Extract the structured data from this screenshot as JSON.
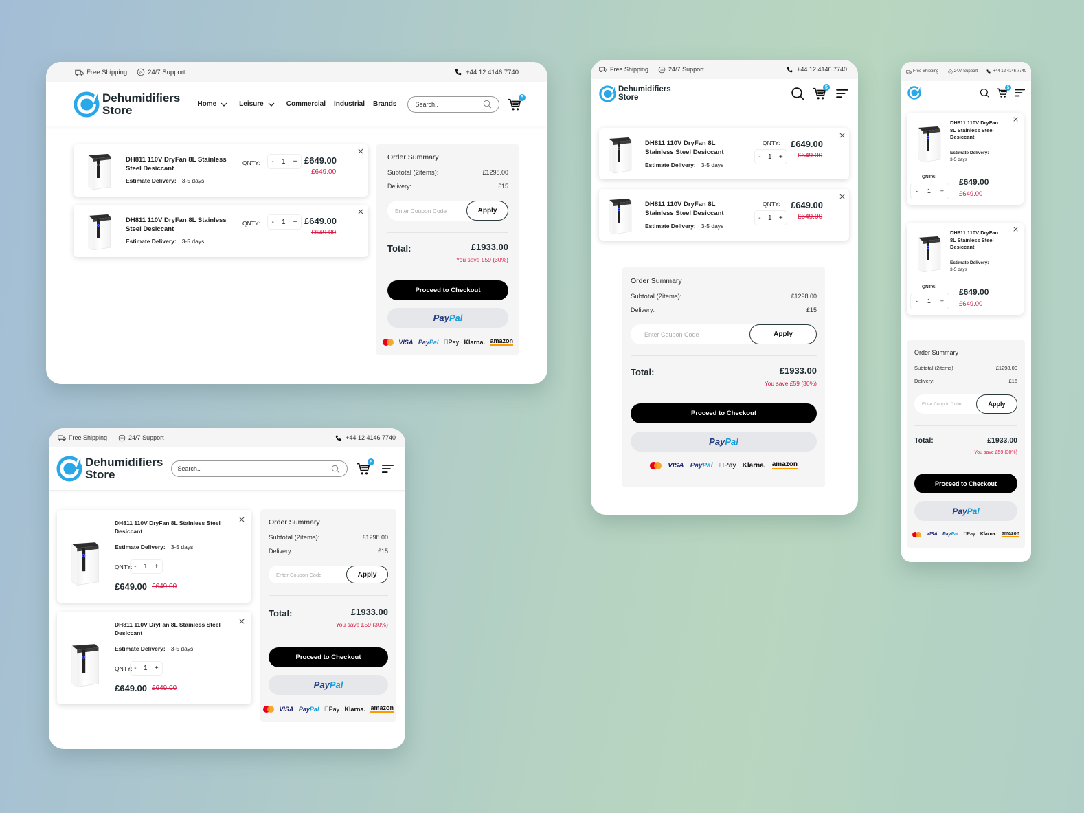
{
  "store": {
    "name_line1": "Dehumidifiers",
    "name_line2": "Store",
    "accent_color": "#2aa7e6",
    "sale_color": "#d81c45"
  },
  "topbar": {
    "shipping": "Free Shipping",
    "support": "24/7 Support",
    "phone": "+44 12 4146 7740"
  },
  "nav": {
    "items": [
      {
        "label": "Home",
        "has_dropdown": true
      },
      {
        "label": "Leisure",
        "has_dropdown": true
      },
      {
        "label": "Commercial",
        "has_dropdown": false
      },
      {
        "label": "Industrial",
        "has_dropdown": false
      },
      {
        "label": "Brands",
        "has_dropdown": false
      }
    ]
  },
  "search": {
    "placeholder": "Search.."
  },
  "cart": {
    "count": "5"
  },
  "icons": {
    "shipping": "truck-icon",
    "support": "clock-24-icon",
    "phone": "phone-icon",
    "search": "search-icon",
    "cart": "cart-icon",
    "menu": "menu-icon",
    "close": "close-icon",
    "dropdown": "chevron-down-icon"
  },
  "cart_items": [
    {
      "name": "DH811 110V DryFan 8L Stainless Steel Desiccant",
      "delivery_label": "Estimate Delivery:",
      "delivery_value": "3-5 days",
      "qty_label": "QNTY:",
      "qty": "1",
      "minus": "-",
      "plus": "+",
      "price": "£649.00",
      "old_price": "£649.00",
      "remove": "×"
    },
    {
      "name": "DH811 110V DryFan 8L Stainless Steel Desiccant",
      "delivery_label": "Estimate Delivery:",
      "delivery_value": "3-5 days",
      "qty_label": "QNTY:",
      "qty": "1",
      "minus": "-",
      "plus": "+",
      "price": "£649.00",
      "old_price": "£649.00",
      "remove": "×"
    }
  ],
  "summary": {
    "title": "Order Summary",
    "subtotal_label": "Subtotal (2items):",
    "subtotal_label_mobile": "Subtotal (2items)",
    "subtotal_value": "£1298.00",
    "delivery_label": "Delivery:",
    "delivery_value": "£15",
    "coupon_placeholder": "Enter Coupon Code",
    "apply_label": "Apply",
    "total_label": "Total:",
    "total_value": "£1933.00",
    "savings": "You save £59 (30%)",
    "checkout_label": "Proceed to Checkout",
    "paypal_part1": "Pay",
    "paypal_part2": "Pal",
    "payment_methods": [
      "Mastercard",
      "VISA",
      "PayPal",
      "Apple Pay",
      "Klarna.",
      "amazon"
    ],
    "payment_labels": {
      "visa": "VISA",
      "paypal": "PayPal",
      "applepay": "Pay",
      "klarna": "Klarna.",
      "amazon": "amazon"
    }
  }
}
